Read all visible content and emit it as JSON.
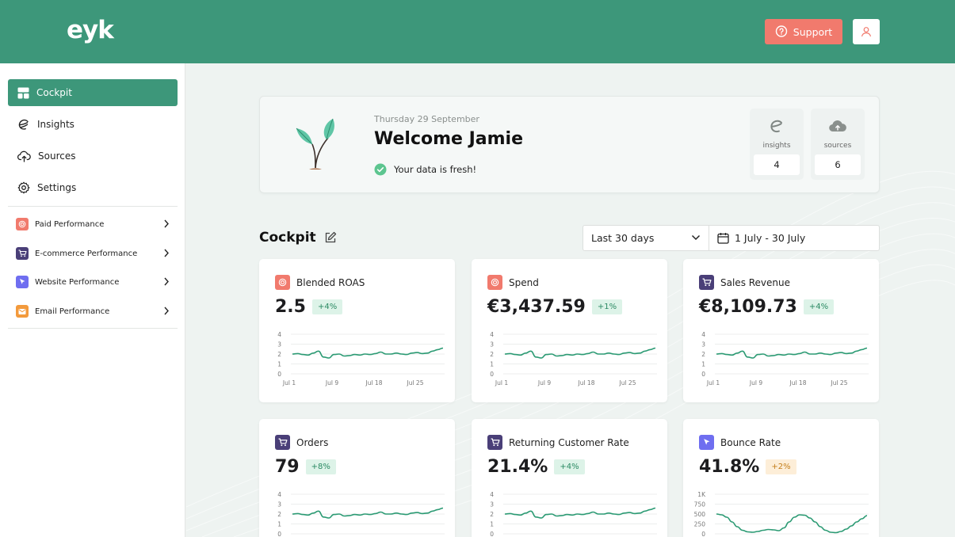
{
  "app": {
    "logo": "eyk"
  },
  "header": {
    "support_label": "Support"
  },
  "sidebar": {
    "items": [
      {
        "label": "Cockpit",
        "icon": "dashboard-icon",
        "active": true
      },
      {
        "label": "Insights",
        "icon": "insights-icon"
      },
      {
        "label": "Sources",
        "icon": "cloud-upload-icon"
      },
      {
        "label": "Settings",
        "icon": "gear-icon"
      }
    ],
    "performance": [
      {
        "label": "Paid Performance",
        "color": "#f17a6d",
        "icon": "target-icon"
      },
      {
        "label": "E-commerce Performance",
        "color": "#4a3f78",
        "icon": "cart-icon"
      },
      {
        "label": "Website Performance",
        "color": "#6f6ef0",
        "icon": "cursor-icon"
      },
      {
        "label": "Email Performance",
        "color": "#f39a3c",
        "icon": "mail-icon"
      }
    ]
  },
  "welcome": {
    "date": "Thursday 29 September",
    "title": "Welcome Jamie",
    "status": "Your data is fresh!",
    "stats": [
      {
        "label": "insights",
        "value": "4",
        "icon": "eyk-icon"
      },
      {
        "label": "sources",
        "value": "6",
        "icon": "cloud-icon"
      }
    ]
  },
  "cockpit": {
    "title": "Cockpit",
    "range": "Last 30 days",
    "dates": "1 July - 30 July"
  },
  "colors": {
    "brand": "#3d977a",
    "accent": "#f17a6d",
    "line": "#2b9a73"
  },
  "cards": [
    {
      "title": "Blended ROAS",
      "value": "2.5",
      "delta": "+4%",
      "delta_type": "up",
      "icon": "target-icon",
      "icon_color": "#f17a6d"
    },
    {
      "title": "Spend",
      "value": "€3,437.59",
      "delta": "+1%",
      "delta_type": "up",
      "icon": "target-icon",
      "icon_color": "#f17a6d"
    },
    {
      "title": "Sales Revenue",
      "value": "€8,109.73",
      "delta": "+4%",
      "delta_type": "up",
      "icon": "cart-icon",
      "icon_color": "#4a3f78"
    },
    {
      "title": "Orders",
      "value": "79",
      "delta": "+8%",
      "delta_type": "up",
      "icon": "cart-icon",
      "icon_color": "#4a3f78"
    },
    {
      "title": "Returning Customer Rate",
      "value": "21.4%",
      "delta": "+4%",
      "delta_type": "up",
      "icon": "cart-icon",
      "icon_color": "#4a3f78"
    },
    {
      "title": "Bounce Rate",
      "value": "41.8%",
      "delta": "+2%",
      "delta_type": "warn",
      "icon": "cursor-icon",
      "icon_color": "#6f6ef0"
    }
  ],
  "chart_data": [
    {
      "type": "line",
      "x_ticks": [
        "Jul 1",
        "Jul 9",
        "Jul 18",
        "Jul 25"
      ],
      "y_ticks": [
        "0",
        "1",
        "2",
        "3",
        "4"
      ],
      "ylim": [
        0,
        4
      ],
      "values": [
        2.0,
        2.05,
        1.95,
        1.9,
        2.1,
        2.3,
        1.7,
        1.6,
        1.95,
        2.0,
        1.8,
        1.85,
        1.95,
        1.9,
        2.0,
        1.95,
        2.05,
        2.2,
        2.0,
        2.0,
        2.1,
        2.0,
        1.95,
        2.1,
        2.15,
        2.05,
        2.1,
        2.3,
        2.45,
        2.6
      ]
    },
    {
      "type": "line",
      "x_ticks": [
        "Jul 1",
        "Jul 9",
        "Jul 18",
        "Jul 25"
      ],
      "y_ticks": [
        "0",
        "1",
        "2",
        "3",
        "4"
      ],
      "ylim": [
        0,
        4
      ],
      "values": [
        2.0,
        2.05,
        1.95,
        1.9,
        2.1,
        2.3,
        1.7,
        1.6,
        1.95,
        2.0,
        1.8,
        1.85,
        1.95,
        1.9,
        2.0,
        1.95,
        2.05,
        2.2,
        2.0,
        2.0,
        2.1,
        2.0,
        1.95,
        2.1,
        2.15,
        2.05,
        2.1,
        2.3,
        2.45,
        2.6
      ]
    },
    {
      "type": "line",
      "x_ticks": [
        "Jul 1",
        "Jul 9",
        "Jul 18",
        "Jul 25"
      ],
      "y_ticks": [
        "0",
        "1",
        "2",
        "3",
        "4"
      ],
      "ylim": [
        0,
        4
      ],
      "values": [
        2.0,
        2.05,
        1.95,
        1.9,
        2.1,
        2.3,
        1.7,
        1.6,
        1.95,
        2.0,
        1.8,
        1.85,
        1.95,
        1.9,
        2.0,
        1.95,
        2.05,
        2.2,
        2.0,
        2.0,
        2.1,
        2.0,
        1.95,
        2.1,
        2.15,
        2.05,
        2.1,
        2.3,
        2.45,
        2.6
      ]
    },
    {
      "type": "line",
      "x_ticks": [],
      "y_ticks": [
        "0",
        "1",
        "2",
        "3",
        "4"
      ],
      "ylim": [
        0,
        4
      ],
      "values": [
        2.0,
        2.05,
        1.95,
        1.9,
        2.1,
        2.3,
        1.7,
        1.6,
        1.95,
        2.0,
        1.8,
        1.85,
        1.95,
        1.9,
        2.0,
        1.95,
        2.05,
        2.2,
        2.0,
        2.0,
        2.1,
        2.0,
        1.95,
        2.1,
        2.15,
        2.05,
        2.1,
        2.3,
        2.45,
        2.6
      ]
    },
    {
      "type": "line",
      "x_ticks": [],
      "y_ticks": [
        "0",
        "1",
        "2",
        "3",
        "4"
      ],
      "ylim": [
        0,
        4
      ],
      "values": [
        2.0,
        2.05,
        1.95,
        1.9,
        2.1,
        2.3,
        1.7,
        1.6,
        1.95,
        2.0,
        1.8,
        1.85,
        1.95,
        1.9,
        2.0,
        1.95,
        2.05,
        2.2,
        2.0,
        2.0,
        2.1,
        2.0,
        1.95,
        2.1,
        2.15,
        2.05,
        2.1,
        2.3,
        2.45,
        2.6
      ]
    },
    {
      "type": "line",
      "x_ticks": [],
      "y_ticks": [
        "0",
        "250",
        "500",
        "750",
        "1K"
      ],
      "ylim": [
        0,
        1000
      ],
      "values": [
        500,
        480,
        420,
        300,
        180,
        90,
        50,
        40,
        60,
        90,
        110,
        100,
        80,
        150,
        300,
        420,
        480,
        470,
        400,
        300,
        180,
        90,
        40,
        30,
        60,
        120,
        200,
        300,
        380,
        460
      ]
    }
  ]
}
